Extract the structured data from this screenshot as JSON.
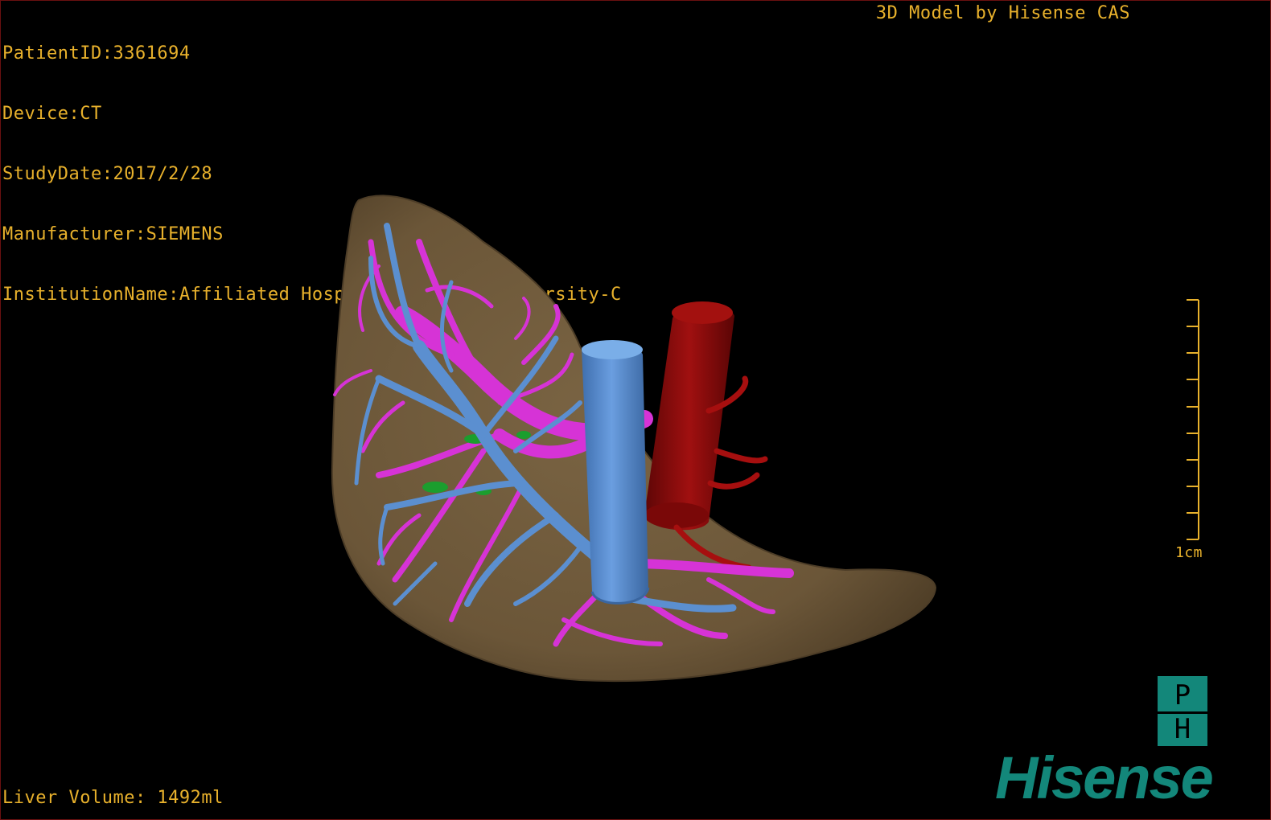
{
  "header": {
    "patient_id": "PatientID:3361694",
    "device": "Device:CT",
    "study_date": "StudyDate:2017/2/28",
    "manufacturer": "Manufacturer:SIEMENS",
    "institution": "InstitutionName:Affiliated Hospital Qingdao University-C",
    "brand_line": "3D Model by Hisense CAS"
  },
  "footer": {
    "volume": "Liver Volume: 1492ml"
  },
  "scale_bar": {
    "label": "1cm"
  },
  "branding": {
    "ph_top": "P",
    "ph_bottom": "H",
    "logo_text": "Hisense",
    "logo_color": "#13877a"
  },
  "colors": {
    "overlay_text": "#e8b12c",
    "liver": "#6b5638",
    "portal_vein": "#5b8fd0",
    "hepatic_vein": "#d633d6",
    "artery": "#8c0a0a",
    "bile_duct": "#1b9e2e"
  },
  "icons": {
    "ph": "ph-badge-icon",
    "logo": "hisense-logo"
  }
}
